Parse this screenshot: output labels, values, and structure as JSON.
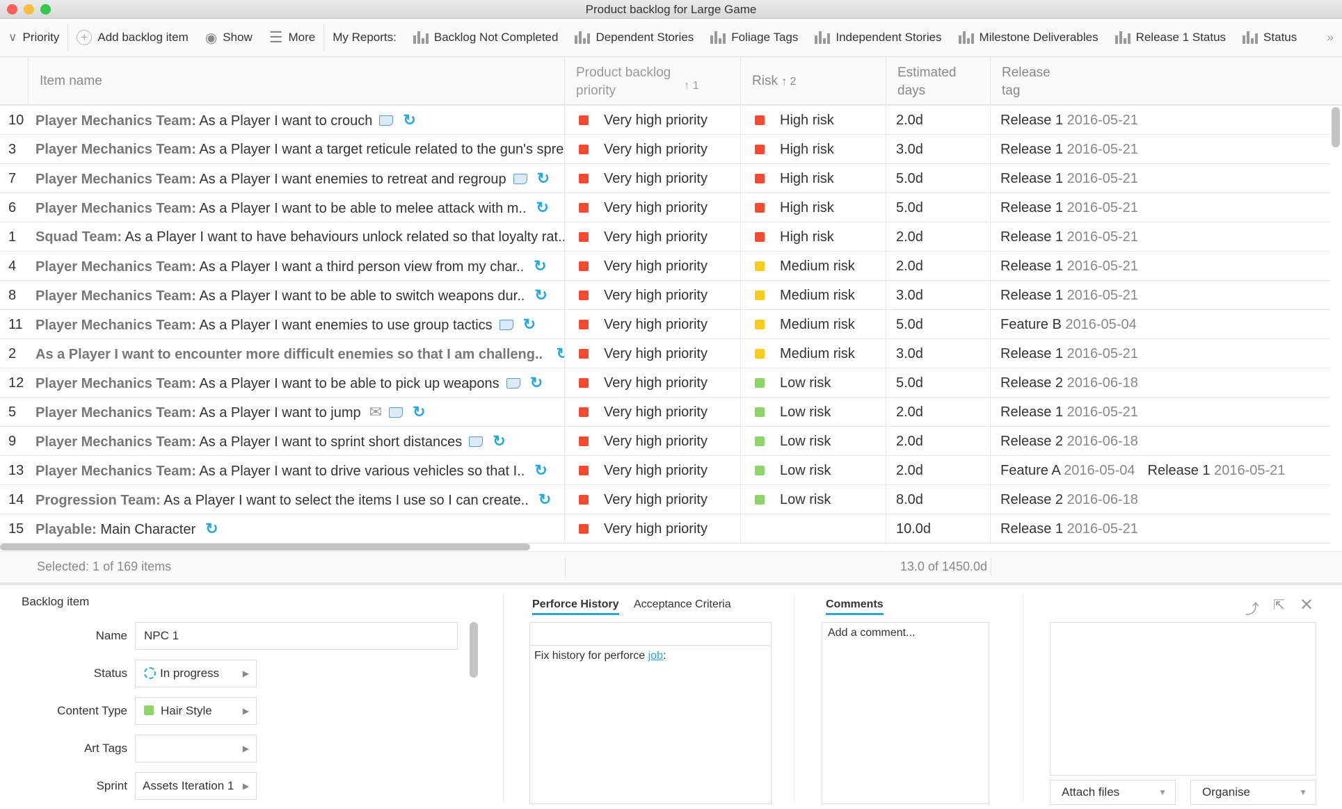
{
  "window": {
    "title": "Product backlog for Large Game"
  },
  "toolbar": {
    "priority": "Priority",
    "add": "Add backlog item",
    "show": "Show",
    "more": "More",
    "reports_label": "My Reports:",
    "reports": [
      "Backlog Not Completed",
      "Dependent Stories",
      "Foliage Tags",
      "Independent Stories",
      "Milestone Deliverables",
      "Release 1 Status",
      "Status"
    ],
    "overflow": "»"
  },
  "columns": {
    "item": "Item name",
    "priority": "Product backlog priority",
    "priority_sort": "↑ 1",
    "risk": "Risk",
    "risk_sort": "↑ 2",
    "est": "Estimated days",
    "release": "Release tag"
  },
  "colors": {
    "very_high": "#f44a30",
    "high": "#f44a30",
    "medium": "#f8cc1b",
    "low": "#8ed567",
    "accent": "#29a8e0"
  },
  "rows": [
    {
      "id": "10",
      "team": "Player Mechanics Team:",
      "text": "As a Player I want to crouch",
      "icons": [
        "doc",
        "refresh"
      ],
      "priority": "Very high priority",
      "risk": "High risk",
      "risk_level": "high",
      "est": "2.0d",
      "tags": [
        {
          "name": "Release 1",
          "date": "2016-05-21"
        }
      ]
    },
    {
      "id": "3",
      "team": "Player Mechanics Team:",
      "text": "As a Player I want a target reticule related to the gun's spre..",
      "icons": [],
      "priority": "Very high priority",
      "risk": "High risk",
      "risk_level": "high",
      "est": "3.0d",
      "tags": [
        {
          "name": "Release 1",
          "date": "2016-05-21"
        }
      ]
    },
    {
      "id": "7",
      "team": "Player Mechanics Team:",
      "text": "As a Player I want enemies to retreat and regroup",
      "icons": [
        "doc",
        "refresh"
      ],
      "priority": "Very high priority",
      "risk": "High risk",
      "risk_level": "high",
      "est": "5.0d",
      "tags": [
        {
          "name": "Release 1",
          "date": "2016-05-21"
        }
      ]
    },
    {
      "id": "6",
      "team": "Player Mechanics Team:",
      "text": "As a Player I want to be able to melee attack with m..",
      "icons": [
        "refresh"
      ],
      "priority": "Very high priority",
      "risk": "High risk",
      "risk_level": "high",
      "est": "5.0d",
      "tags": [
        {
          "name": "Release 1",
          "date": "2016-05-21"
        }
      ]
    },
    {
      "id": "1",
      "team": "Squad Team:",
      "text": "As a Player I want to have behaviours unlock related so that loyalty rat..",
      "icons": [],
      "priority": "Very high priority",
      "risk": "High risk",
      "risk_level": "high",
      "est": "2.0d",
      "tags": [
        {
          "name": "Release 1",
          "date": "2016-05-21"
        }
      ]
    },
    {
      "id": "4",
      "team": "Player Mechanics Team:",
      "text": "As a Player I want a third person view from my char..",
      "icons": [
        "refresh"
      ],
      "priority": "Very high priority",
      "risk": "Medium risk",
      "risk_level": "medium",
      "est": "2.0d",
      "tags": [
        {
          "name": "Release 1",
          "date": "2016-05-21"
        }
      ]
    },
    {
      "id": "8",
      "team": "Player Mechanics Team:",
      "text": "As a Player I want to be able to switch weapons dur..",
      "icons": [
        "refresh"
      ],
      "priority": "Very high priority",
      "risk": "Medium risk",
      "risk_level": "medium",
      "est": "3.0d",
      "tags": [
        {
          "name": "Release 1",
          "date": "2016-05-21"
        }
      ]
    },
    {
      "id": "11",
      "team": "Player Mechanics Team:",
      "text": "As a Player I want enemies to use group tactics",
      "icons": [
        "doc",
        "refresh"
      ],
      "priority": "Very high priority",
      "risk": "Medium risk",
      "risk_level": "medium",
      "est": "5.0d",
      "tags": [
        {
          "name": "Feature B",
          "date": "2016-05-04"
        }
      ]
    },
    {
      "id": "2",
      "team": "As a Player I want to encounter more difficult enemies so that I am challeng..",
      "text": "",
      "icons": [
        "refresh"
      ],
      "priority": "Very high priority",
      "risk": "Medium risk",
      "risk_level": "medium",
      "est": "3.0d",
      "tags": [
        {
          "name": "Release 1",
          "date": "2016-05-21"
        }
      ]
    },
    {
      "id": "12",
      "team": "Player Mechanics Team:",
      "text": "As a Player I want to be able to pick up weapons",
      "icons": [
        "doc",
        "refresh"
      ],
      "priority": "Very high priority",
      "risk": "Low risk",
      "risk_level": "low",
      "est": "5.0d",
      "tags": [
        {
          "name": "Release 2",
          "date": "2016-06-18"
        }
      ]
    },
    {
      "id": "5",
      "team": "Player Mechanics Team:",
      "text": "As a Player I want to jump",
      "icons": [
        "mail",
        "doc",
        "refresh"
      ],
      "priority": "Very high priority",
      "risk": "Low risk",
      "risk_level": "low",
      "est": "2.0d",
      "tags": [
        {
          "name": "Release 1",
          "date": "2016-05-21"
        }
      ]
    },
    {
      "id": "9",
      "team": "Player Mechanics Team:",
      "text": "As a Player I want to sprint short distances",
      "icons": [
        "doc",
        "refresh"
      ],
      "priority": "Very high priority",
      "risk": "Low risk",
      "risk_level": "low",
      "est": "2.0d",
      "tags": [
        {
          "name": "Release 2",
          "date": "2016-06-18"
        }
      ]
    },
    {
      "id": "13",
      "team": "Player Mechanics Team:",
      "text": "As a Player I want to drive various vehicles so that I..",
      "icons": [
        "refresh"
      ],
      "priority": "Very high priority",
      "risk": "Low risk",
      "risk_level": "low",
      "est": "2.0d",
      "tags": [
        {
          "name": "Feature A",
          "date": "2016-05-04"
        },
        {
          "name": "Release 1",
          "date": "2016-05-21"
        }
      ]
    },
    {
      "id": "14",
      "team": "Progression Team:",
      "text": "As a Player I want to select the items I use so I can create..",
      "icons": [
        "refresh"
      ],
      "priority": "Very high priority",
      "risk": "Low risk",
      "risk_level": "low",
      "est": "8.0d",
      "tags": [
        {
          "name": "Release 2",
          "date": "2016-06-18"
        }
      ]
    },
    {
      "id": "15",
      "team": "Playable:",
      "text": "Main Character",
      "icons": [
        "refresh"
      ],
      "priority": "Very high priority",
      "risk": "",
      "risk_level": "",
      "est": "10.0d",
      "tags": [
        {
          "name": "Release 1",
          "date": "2016-05-21"
        }
      ]
    }
  ],
  "footer": {
    "selected": "Selected: 1 of 169 items",
    "total": "13.0 of 1450.0d"
  },
  "detail": {
    "title": "Backlog item",
    "name_label": "Name",
    "name_value": "NPC 1",
    "status_label": "Status",
    "status_value": "In progress",
    "content_label": "Content Type",
    "content_value": "Hair Style",
    "art_label": "Art Tags",
    "art_value": "",
    "sprint_label": "Sprint",
    "sprint_value": "Assets Iteration 1"
  },
  "history": {
    "tabs": [
      "Perforce History",
      "Acceptance Criteria"
    ],
    "text": "Fix history for perforce ",
    "link": "job",
    "suffix": ":"
  },
  "comments": {
    "tab": "Comments",
    "placeholder": "Add a comment..."
  },
  "attachments": {
    "attach": "Attach files",
    "organise": "Organise"
  }
}
